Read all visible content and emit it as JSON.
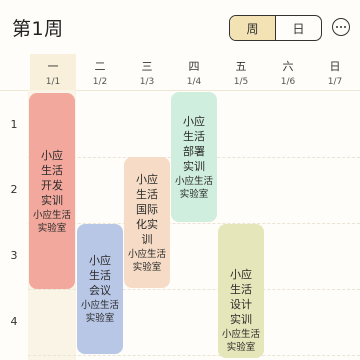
{
  "header": {
    "week_title": "第1周",
    "view_toggle": {
      "week_label": "周",
      "day_label": "日",
      "selected": "周"
    },
    "more_icon": "more-horizontal-icon"
  },
  "days": [
    {
      "name": "一",
      "date": "1/1",
      "today": true
    },
    {
      "name": "二",
      "date": "1/2",
      "today": false
    },
    {
      "name": "三",
      "date": "1/3",
      "today": false
    },
    {
      "name": "四",
      "date": "1/4",
      "today": false
    },
    {
      "name": "五",
      "date": "1/5",
      "today": false
    },
    {
      "name": "六",
      "date": "1/6",
      "today": false
    },
    {
      "name": "日",
      "date": "1/7",
      "today": false
    }
  ],
  "periods": [
    "1",
    "2",
    "3",
    "4"
  ],
  "courses": [
    {
      "name": "小应生活开发实训",
      "room": "小应生活实验室",
      "color": "#f2a89c"
    },
    {
      "name": "小应生活会议",
      "room": "小应生活实验室",
      "color": "#b9c7e6"
    },
    {
      "name": "小应生活国际化实训",
      "room": "小应生活实验室",
      "color": "#f6dcc6"
    },
    {
      "name": "小应生活部署实训",
      "room": "小应生活实验室",
      "color": "#cfeedd"
    },
    {
      "name": "小应生活设计实训",
      "room": "小应生活实验室",
      "color": "#e5e6ba"
    }
  ]
}
